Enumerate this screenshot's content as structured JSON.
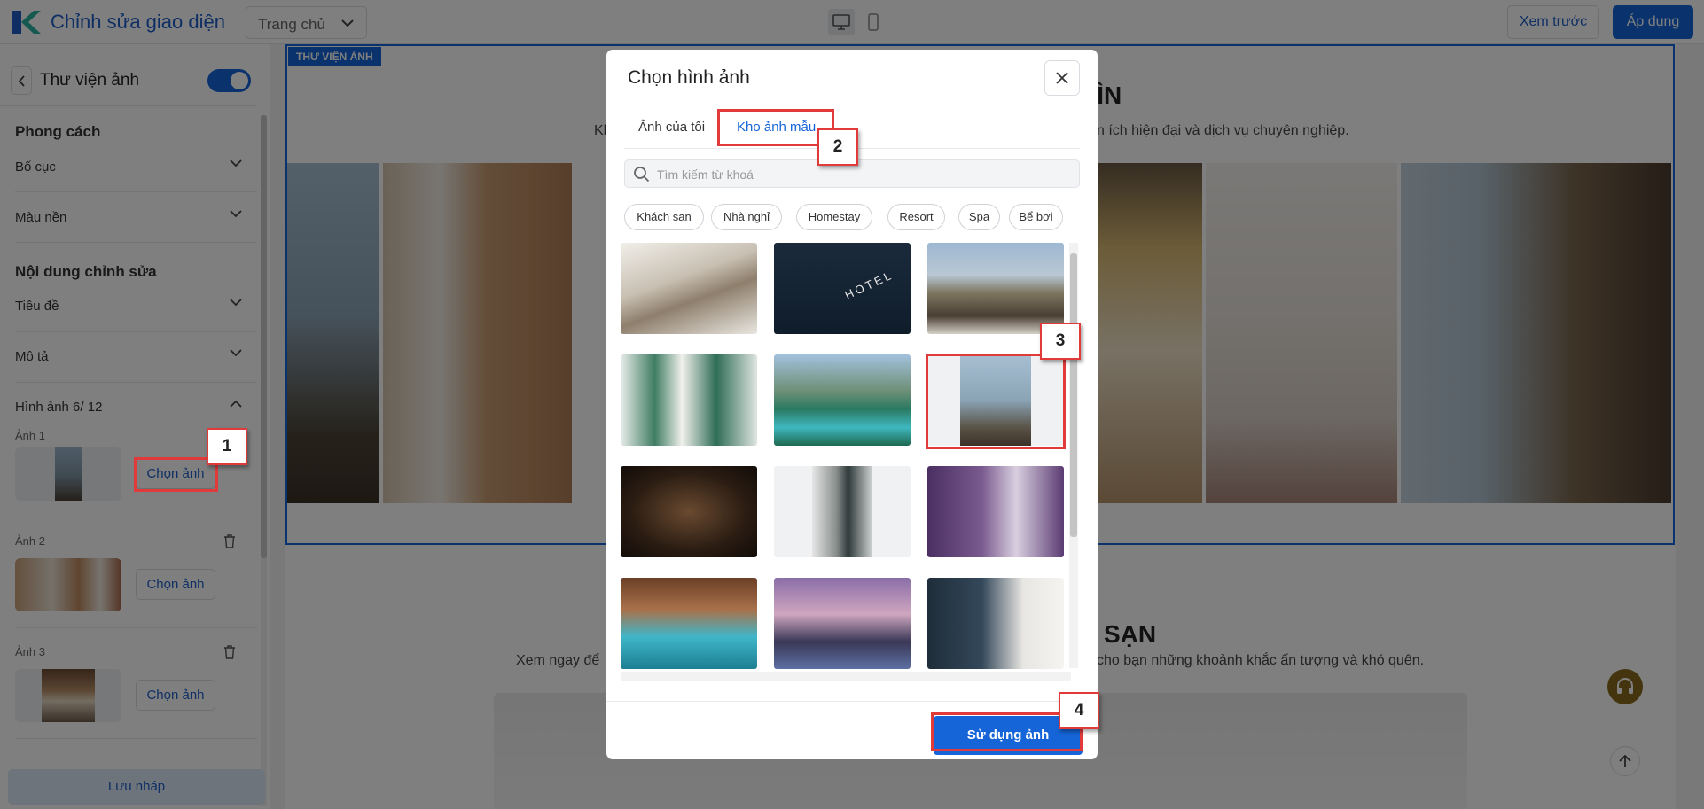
{
  "topbar": {
    "title": "Chỉnh sửa giao diện",
    "page_select": "Trang chủ",
    "preview_label": "Xem trước",
    "apply_label": "Áp dụng"
  },
  "sidebar": {
    "title": "Thư viện ảnh",
    "style_heading": "Phong cách",
    "layout_label": "Bố cục",
    "bg_label": "Màu nền",
    "content_heading": "Nội dung chỉnh sửa",
    "title_label": "Tiêu đề",
    "desc_label": "Mô tả",
    "images_label": "Hình ảnh 6/ 12",
    "items": [
      {
        "label": "Ảnh 1",
        "button": "Chọn ảnh"
      },
      {
        "label": "Ảnh 2",
        "button": "Chọn ảnh"
      },
      {
        "label": "Ảnh 3",
        "button": "Chọn ảnh"
      }
    ],
    "save_draft": "Lưu nháp"
  },
  "canvas": {
    "section_tag": "THƯ VIỆN ẢNH",
    "heading_fragment": "HÌN",
    "desc_left_fragment": "Kh",
    "desc_right_fragment": "n ích hiện đại và dịch vụ chuyên nghiệp.",
    "heading2_fragment": "H SẠN",
    "desc2_left": "Xem ngay để",
    "desc2_right": "cho bạn những khoảnh khắc ấn tượng và khó quên."
  },
  "modal": {
    "title": "Chọn hình ảnh",
    "tab_mine": "Ảnh của tôi",
    "tab_stock": "Kho ảnh mẫu",
    "search_placeholder": "Tìm kiếm từ khoá",
    "chips": [
      "Khách sạn",
      "Nhà nghỉ",
      "Homestay",
      "Resort",
      "Spa",
      "Bể bơi"
    ],
    "hotel_sign": "HOTEL",
    "use_button": "Sử dụng ảnh"
  },
  "callouts": [
    "1",
    "2",
    "3",
    "4"
  ],
  "colors": {
    "accent": "#1565d8",
    "callout": "#e03a3a"
  }
}
